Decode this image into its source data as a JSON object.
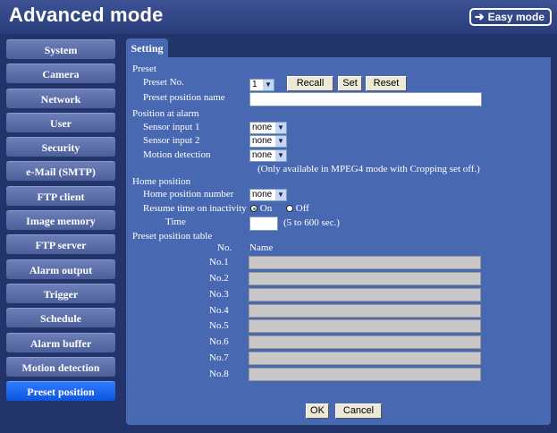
{
  "header": {
    "title": "Advanced mode",
    "easy_mode_label": "Easy mode"
  },
  "sidebar": {
    "items": [
      {
        "label": "System"
      },
      {
        "label": "Camera"
      },
      {
        "label": "Network"
      },
      {
        "label": "User"
      },
      {
        "label": "Security"
      },
      {
        "label": "e-Mail (SMTP)"
      },
      {
        "label": "FTP client"
      },
      {
        "label": "Image memory"
      },
      {
        "label": "FTP server"
      },
      {
        "label": "Alarm output"
      },
      {
        "label": "Trigger"
      },
      {
        "label": "Schedule"
      },
      {
        "label": "Alarm buffer"
      },
      {
        "label": "Motion detection"
      },
      {
        "label": "Preset position"
      }
    ],
    "active": "Preset position"
  },
  "tab": {
    "label": "Setting"
  },
  "preset": {
    "section": "Preset",
    "no_label": "Preset No.",
    "no_value": "1",
    "recall": "Recall",
    "set": "Set",
    "reset": "Reset",
    "name_label": "Preset position name",
    "name_value": ""
  },
  "alarm": {
    "section": "Position at alarm",
    "sensor1_label": "Sensor input 1",
    "sensor1_value": "none",
    "sensor2_label": "Sensor input 2",
    "sensor2_value": "none",
    "motion_label": "Motion detection",
    "motion_value": "none",
    "note": "(Only available in MPEG4 mode with Cropping set off.)"
  },
  "home": {
    "section": "Home position",
    "number_label": "Home position number",
    "number_value": "none",
    "resume_label": "Resume time on inactivity",
    "on_label": "On",
    "off_label": "Off",
    "time_label": "Time",
    "time_value": "",
    "time_hint": "(5 to 600 sec.)"
  },
  "table": {
    "section": "Preset position table",
    "col_no": "No.",
    "col_name": "Name",
    "rows": [
      {
        "no": "No.1",
        "name": ""
      },
      {
        "no": "No.2",
        "name": ""
      },
      {
        "no": "No.3",
        "name": ""
      },
      {
        "no": "No.4",
        "name": ""
      },
      {
        "no": "No.5",
        "name": ""
      },
      {
        "no": "No.6",
        "name": ""
      },
      {
        "no": "No.7",
        "name": ""
      },
      {
        "no": "No.8",
        "name": ""
      }
    ]
  },
  "footer": {
    "ok": "OK",
    "cancel": "Cancel"
  },
  "icons": {
    "easy_mode": "arrow-right-icon",
    "dropdown": "chevron-down-icon"
  },
  "colors": {
    "panel": "#4968b2",
    "active_nav": "#0c55e0",
    "background": "#22346a"
  }
}
